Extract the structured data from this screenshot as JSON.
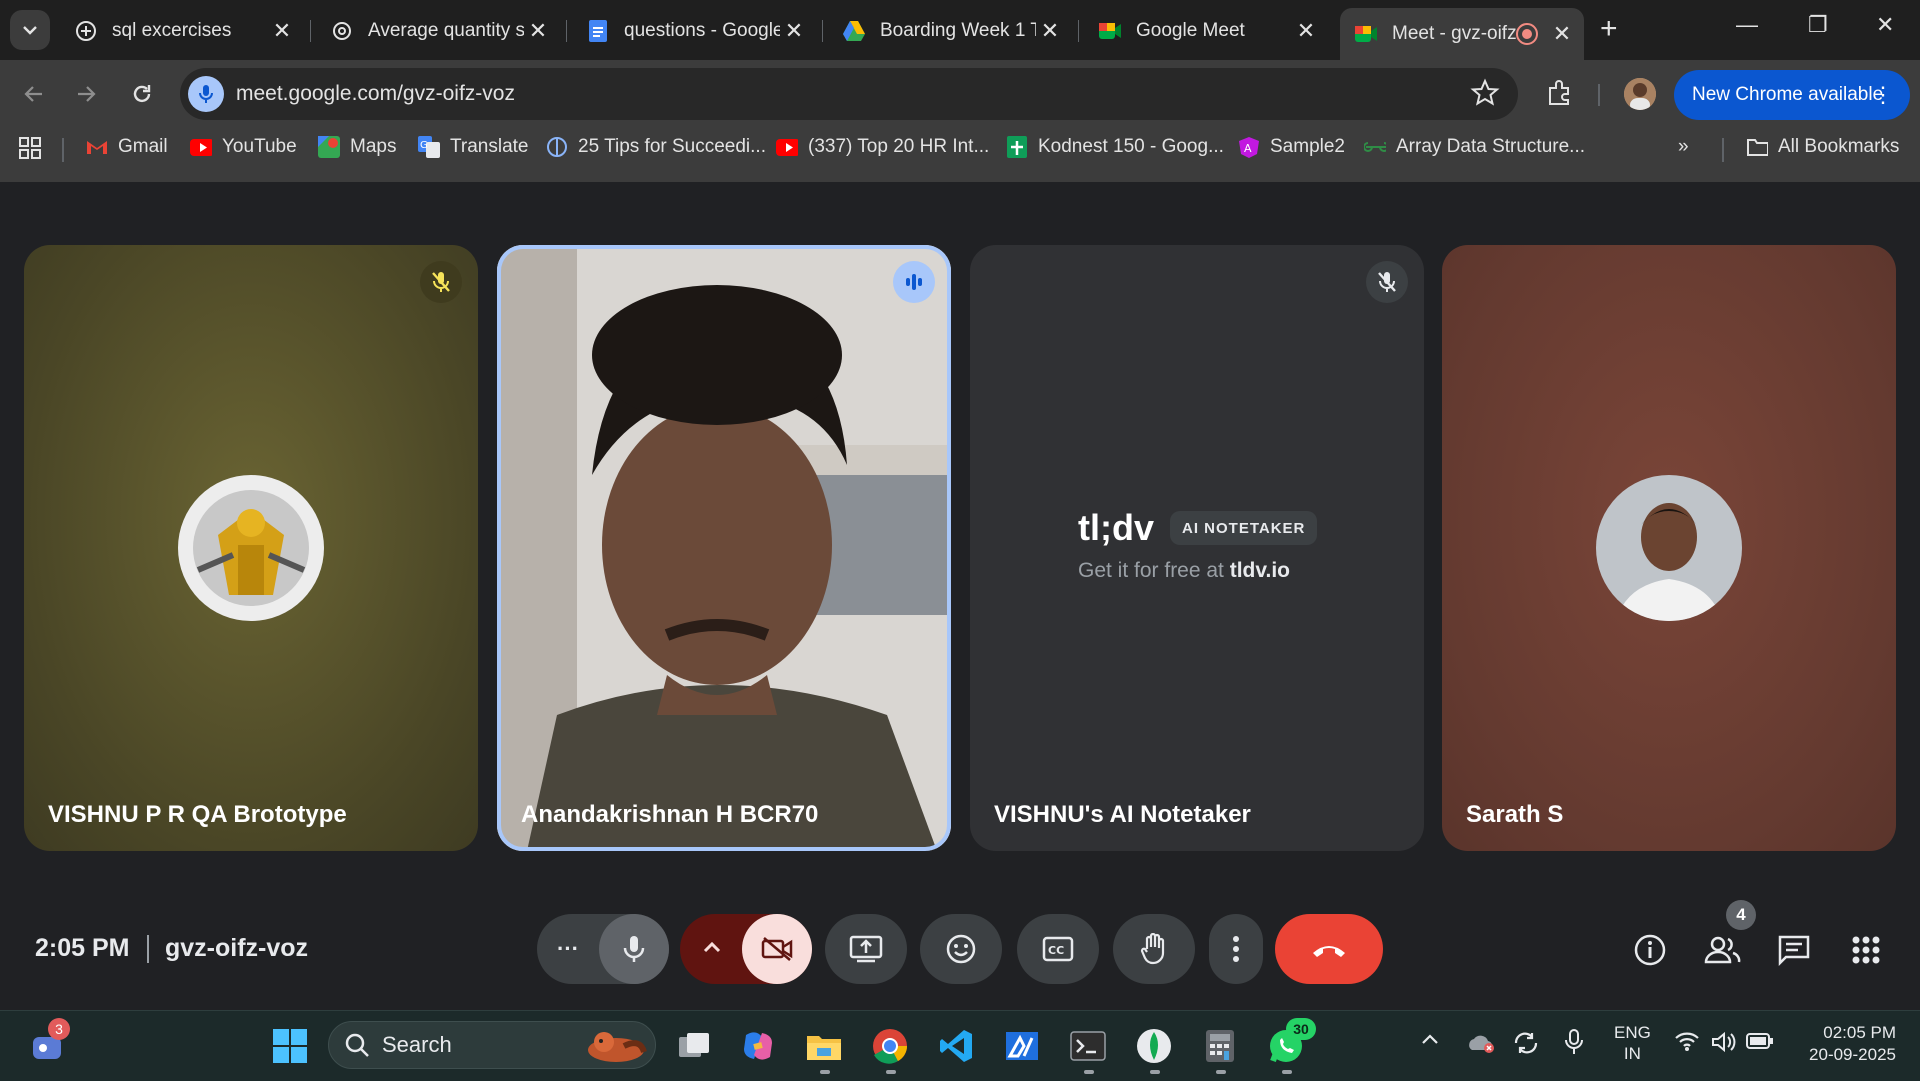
{
  "browser": {
    "tabs": [
      {
        "title": "sql excercises",
        "icon": "tab-favicon-default"
      },
      {
        "title": "Average quantity s",
        "icon": "chatgpt-icon"
      },
      {
        "title": "questions - Google",
        "icon": "google-docs-icon"
      },
      {
        "title": "Boarding Week 1 T",
        "icon": "google-drive-icon"
      },
      {
        "title": "Google Meet",
        "icon": "google-meet-icon"
      },
      {
        "title": "Meet - gvz-oifz",
        "icon": "google-meet-icon",
        "active": true
      }
    ],
    "url": "meet.google.com/gvz-oifz-voz",
    "update_button": "New Chrome available",
    "bookmarks": [
      {
        "label": "Gmail",
        "icon": "gmail-icon"
      },
      {
        "label": "YouTube",
        "icon": "youtube-icon"
      },
      {
        "label": "Maps",
        "icon": "maps-icon"
      },
      {
        "label": "Translate",
        "icon": "translate-icon"
      },
      {
        "label": "25 Tips for Succeedi...",
        "icon": "globe-icon"
      },
      {
        "label": "(337) Top 20 HR Int...",
        "icon": "youtube-icon"
      },
      {
        "label": "Kodnest 150 - Goog...",
        "icon": "sheets-icon"
      },
      {
        "label": "Sample2",
        "icon": "angular-icon"
      },
      {
        "label": "Array Data Structure...",
        "icon": "gfg-icon"
      }
    ],
    "all_bookmarks": "All Bookmarks"
  },
  "meet": {
    "participants": [
      {
        "name": "VISHNU P R QA Brototype",
        "mic": "muted",
        "bg": "#55512a"
      },
      {
        "name": "Anandakrishnan H BCR70",
        "mic": "speaking",
        "bg": "#6e6259"
      },
      {
        "name": "VISHNU's AI Notetaker",
        "mic": "muted",
        "bg": "#303134"
      },
      {
        "name": "Sarath S",
        "mic": "none",
        "bg": "#6e3e33"
      }
    ],
    "notetaker": {
      "logo": "tl;dv",
      "badge": "AI NOTETAKER",
      "sub_prefix": "Get it for free at ",
      "sub_link": "tldv.io"
    },
    "time": "2:05 PM",
    "meeting_code": "gvz-oifz-voz",
    "people_count": "4",
    "colors": {
      "end_call": "#ea4335",
      "camera_off": "#f9dedc",
      "camera_toggle": "#601410",
      "speaking_ring": "#a8c7fa"
    }
  },
  "taskbar": {
    "search_placeholder": "Search",
    "notification_badge": "3",
    "whatsapp_badge": "30",
    "lang": "ENG",
    "region": "IN",
    "time": "02:05 PM",
    "date": "20-09-2025"
  }
}
